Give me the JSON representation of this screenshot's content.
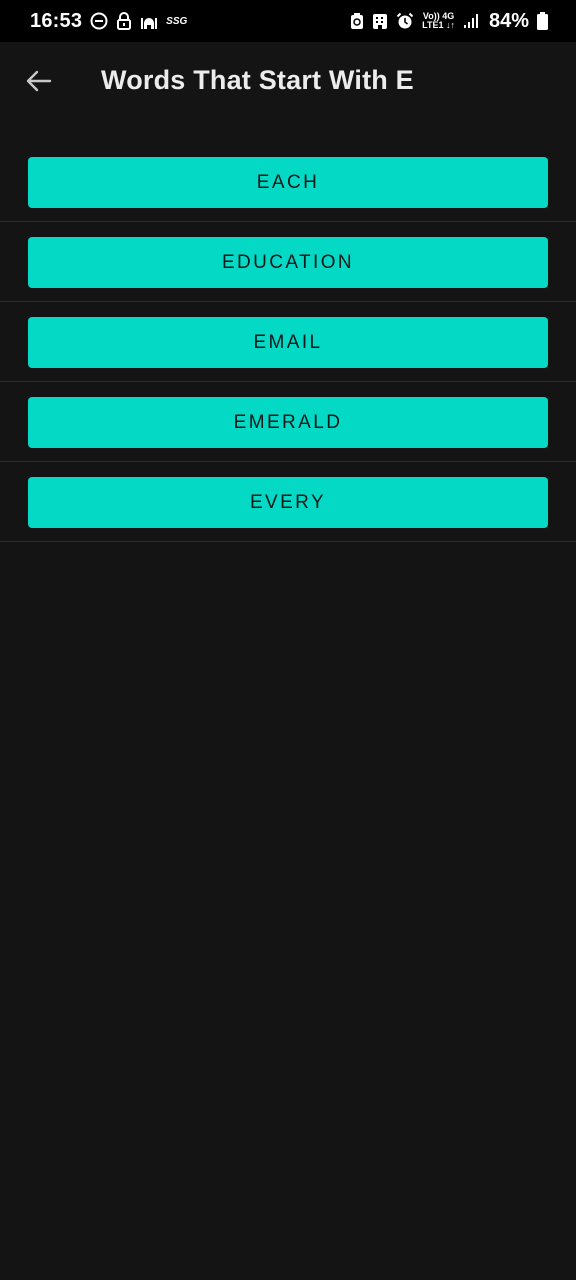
{
  "status_bar": {
    "time": "16:53",
    "carrier_badge": "SSG",
    "network_top": "Vo)) 4G",
    "network_bottom": "LTE1 ↓↑",
    "battery": "84%"
  },
  "app_bar": {
    "title": "Words That Start With E",
    "back_icon": "arrow-left-icon"
  },
  "words": [
    {
      "label": "EACH"
    },
    {
      "label": "EDUCATION"
    },
    {
      "label": "EMAIL"
    },
    {
      "label": "EMERALD"
    },
    {
      "label": "EVERY"
    }
  ],
  "colors": {
    "background": "#141414",
    "button": "#04d9c6",
    "divider": "#2e2e2e"
  }
}
